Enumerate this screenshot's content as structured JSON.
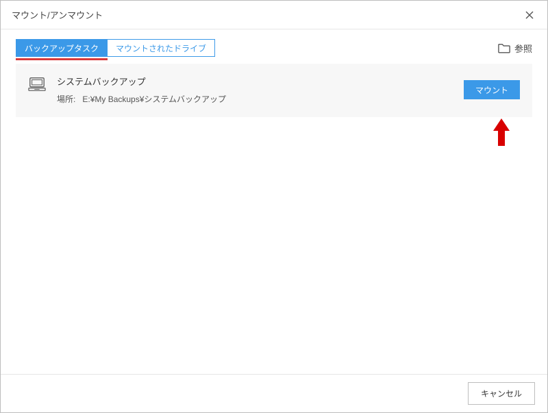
{
  "window": {
    "title": "マウント/アンマウント"
  },
  "tabs": {
    "backup_tasks": "バックアップタスク",
    "mounted_drives": "マウントされたドライブ"
  },
  "browse": {
    "label": "参照"
  },
  "backup": {
    "name": "システムバックアップ",
    "location_label": "場所:",
    "location_value": "E:¥My Backups¥システムバックアップ",
    "mount_button": "マウント"
  },
  "footer": {
    "cancel": "キャンセル"
  }
}
